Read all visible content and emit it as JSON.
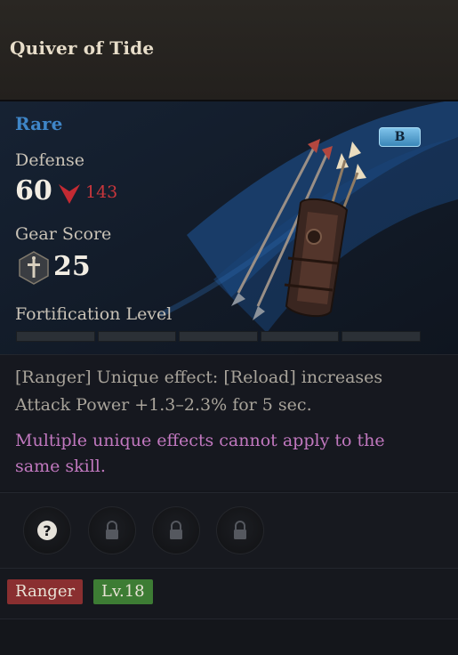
{
  "item": {
    "name": "Quiver of Tide",
    "rarity": "Rare",
    "grade": "B",
    "defense_label": "Defense",
    "defense_value": "60",
    "defense_delta": "143",
    "gear_score_label": "Gear Score",
    "gear_score_value": "25",
    "fortification_label": "Fortification Level",
    "fortification_segments": 5,
    "fortification_filled": 0
  },
  "description": {
    "effect": "[Ranger] Unique effect: [Reload] increases Attack Power +1.3–2.3% for 5 sec.",
    "note": "Multiple unique effects cannot apply to the same skill."
  },
  "sockets": [
    {
      "icon": "question-icon"
    },
    {
      "icon": "lock-icon"
    },
    {
      "icon": "lock-icon"
    },
    {
      "icon": "lock-icon"
    }
  ],
  "tags": {
    "class": "Ranger",
    "level": "Lv.18"
  },
  "colors": {
    "rarity": "#3f86c8",
    "delta_negative": "#c8363c",
    "class_tag": "#8a2f30",
    "level_tag": "#3d7c34",
    "note_text": "#c178bf"
  }
}
